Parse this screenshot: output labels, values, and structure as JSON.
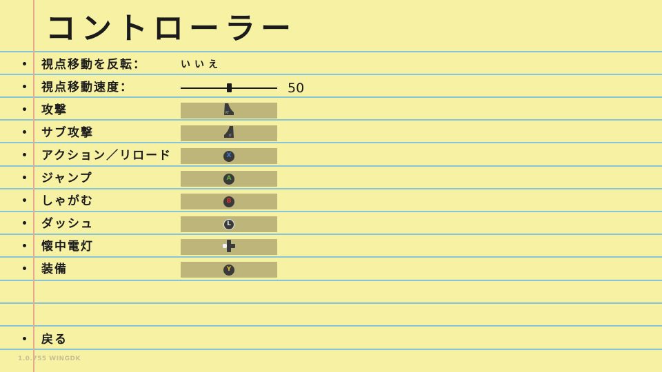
{
  "title": "コントローラー",
  "settings": [
    {
      "label": "視点移動を反転：",
      "type": "text",
      "value": "いいえ"
    },
    {
      "label": "視点移動速度：",
      "type": "slider",
      "value": "50",
      "level": 0.5
    },
    {
      "label": "攻撃",
      "type": "binding",
      "icon": "rt-trigger-icon"
    },
    {
      "label": "サブ攻撃",
      "type": "binding",
      "icon": "lt-trigger-icon"
    },
    {
      "label": "アクション／リロード",
      "type": "binding",
      "icon": "x-button-icon",
      "glyph": "X",
      "color": "#3f7bd6"
    },
    {
      "label": "ジャンプ",
      "type": "binding",
      "icon": "a-button-icon",
      "glyph": "A",
      "color": "#5fae3a"
    },
    {
      "label": "しゃがむ",
      "type": "binding",
      "icon": "b-button-icon",
      "glyph": "B",
      "color": "#d03b35"
    },
    {
      "label": "ダッシュ",
      "type": "binding",
      "icon": "left-stick-icon",
      "glyph": "L",
      "color": "#e8e8e8"
    },
    {
      "label": "懐中電灯",
      "type": "binding",
      "icon": "dpad-left-icon"
    },
    {
      "label": "装備",
      "type": "binding",
      "icon": "y-button-icon",
      "glyph": "Y",
      "color": "#e3b934"
    }
  ],
  "back_label": "戻る",
  "version": "1.0.755 WINGDK",
  "colors": {
    "paper": "#f7f1a3",
    "rule": "#86c4d8",
    "margin": "#e6a88f",
    "binding_box": "#bdb57a"
  }
}
